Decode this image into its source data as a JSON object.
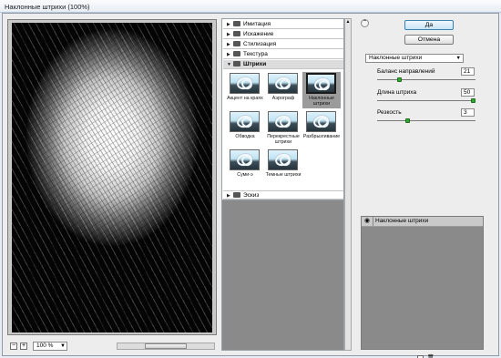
{
  "window": {
    "title": "Наклонные штрихи (100%)"
  },
  "preview": {
    "zoom": "100 %",
    "zoom_out": "−",
    "zoom_in": "+"
  },
  "categories": [
    {
      "label": "Имитация",
      "expanded": false
    },
    {
      "label": "Искажение",
      "expanded": false
    },
    {
      "label": "Стилизация",
      "expanded": false
    },
    {
      "label": "Текстура",
      "expanded": false
    },
    {
      "label": "Штрихи",
      "expanded": true
    },
    {
      "label": "Эскиз",
      "expanded": false
    }
  ],
  "thumbnails": [
    {
      "label": "Акцент на краях",
      "selected": false
    },
    {
      "label": "Аэрограф",
      "selected": false
    },
    {
      "label": "Наклонные штрихи",
      "selected": true
    },
    {
      "label": "Обводка",
      "selected": false
    },
    {
      "label": "Перекрестные штрихи",
      "selected": false
    },
    {
      "label": "Разбрызгивание",
      "selected": false
    },
    {
      "label": "Суми-э",
      "selected": false
    },
    {
      "label": "Темные штрихи",
      "selected": false
    }
  ],
  "buttons": {
    "ok": "Да",
    "cancel": "Отмена"
  },
  "filter_select": {
    "value": "Наклонные штрихи"
  },
  "params": [
    {
      "label": "Баланс направлений",
      "value": "21",
      "fraction": 0.21
    },
    {
      "label": "Длина штриха",
      "value": "50",
      "fraction": 1.0
    },
    {
      "label": "Резкость",
      "value": "3",
      "fraction": 0.3
    }
  ],
  "layers": [
    {
      "name": "Наклонные штрихи",
      "visible": true
    }
  ],
  "icons": {
    "collapse": "double-chevron-up-icon",
    "eye": "eye-icon",
    "new_layer": "new-layer-icon",
    "delete_layer": "trash-icon",
    "dropdown": "chevron-down-icon"
  }
}
